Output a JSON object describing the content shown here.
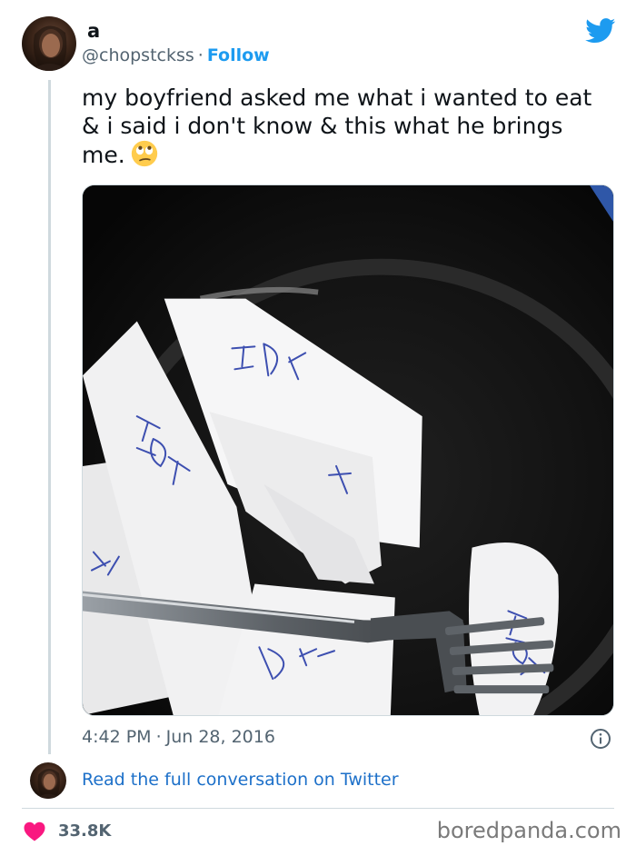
{
  "tweet": {
    "author_name": "a",
    "handle": "@chopstckss",
    "separator": "·",
    "follow_label": "Follow",
    "text": "my boyfriend asked me what i wanted to eat\n& i said i don't know & this what he brings\nme.",
    "emoji": "eye-roll-emoji",
    "photo": {
      "paper_labels": [
        "IDK",
        "IDK",
        "I",
        "IDK",
        "IDK",
        "IDK"
      ]
    },
    "time": "4:42 PM",
    "date": "Jun 28, 2016",
    "read_more_label": "Read the full conversation on Twitter",
    "likes": "33.8K"
  },
  "icons": {
    "brand": "twitter-bird-icon",
    "info": "info-icon",
    "like": "heart-icon"
  },
  "colors": {
    "twitter_blue": "#1d9bf0",
    "link_blue": "#1d70c9",
    "heart_red": "#f91880",
    "muted_text": "#536471"
  },
  "watermark": "boredpanda.com"
}
